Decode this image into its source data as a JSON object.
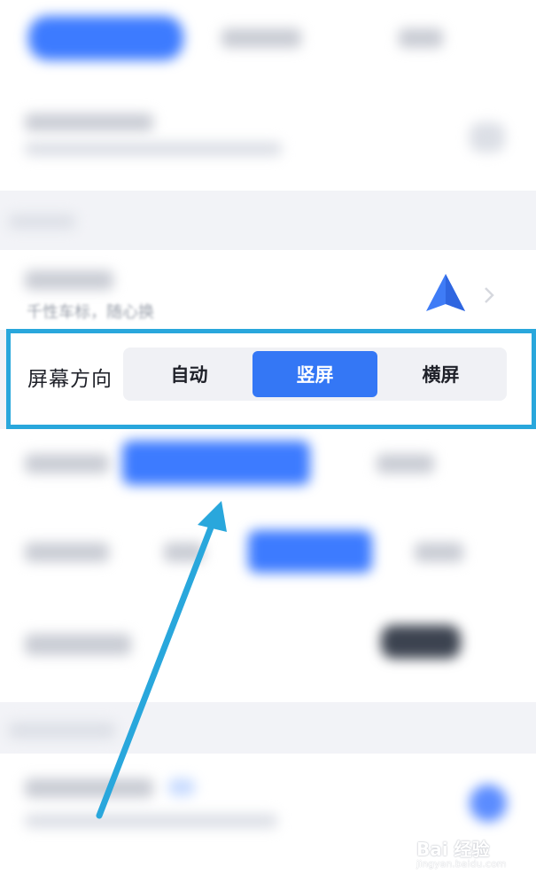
{
  "orientation": {
    "label": "屏幕方向",
    "options": [
      "自动",
      "竖屏",
      "横屏"
    ],
    "selected": "竖屏"
  },
  "above_row": {
    "subtitle": "千性车标，随心换"
  },
  "watermark": {
    "text": "Bai 经验",
    "sub": "jingyan.baidu.com"
  },
  "colors": {
    "accent": "#3477f5",
    "highlight_border": "#29a7dc",
    "arrow": "#29a7dc"
  },
  "icons": [
    "navigation-arrow-icon",
    "chevron-right-icon",
    "pointer-arrow-icon"
  ]
}
